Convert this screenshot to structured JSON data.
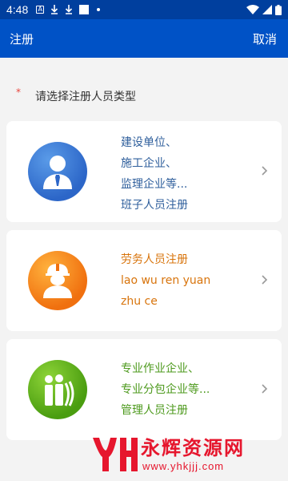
{
  "status_bar": {
    "time": "4:48",
    "icons": [
      "notification-a-icon",
      "download-icon",
      "download-icon",
      "image-icon",
      "dot-icon"
    ],
    "right_icons": [
      "wifi-icon",
      "signal-icon",
      "battery-icon"
    ]
  },
  "app_bar": {
    "title": "注册",
    "cancel_label": "取消"
  },
  "section": {
    "required_mark": "*",
    "label": "请选择注册人员类型"
  },
  "cards": [
    {
      "icon": "person-tie-icon",
      "color": "#2c66c8",
      "lines": [
        "建设单位、",
        "施工企业、",
        "监理企业等...",
        "班子人员注册"
      ]
    },
    {
      "icon": "worker-helmet-icon",
      "color": "#f0700f",
      "lines": [
        "劳务人员注册",
        "lao wu ren yuan",
        "zhu ce"
      ]
    },
    {
      "icon": "group-people-icon",
      "color": "#4a9d10",
      "lines": [
        "专业作业企业、",
        "专业分包企业等...",
        "管理人员注册"
      ]
    }
  ],
  "watermark": {
    "text": "永辉资源网",
    "url": "www.yhkjjj.com"
  }
}
